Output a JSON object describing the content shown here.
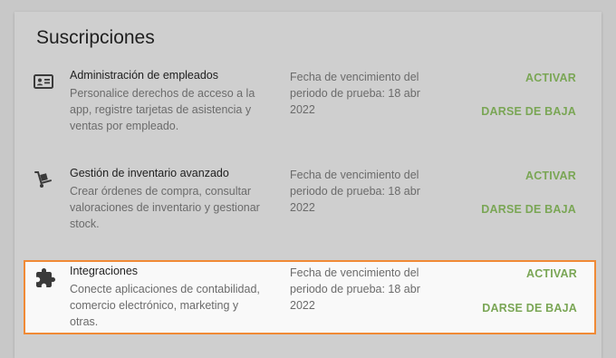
{
  "title": "Suscripciones",
  "accent_color": "#7aa655",
  "highlight_color": "#f08a36",
  "subscriptions": [
    {
      "icon": "id-card-icon",
      "name": "Administración de empleados",
      "description": "Personalice derechos de acceso a la app, registre tarjetas de asistencia y ventas por empleado.",
      "expiry": "Fecha de vencimiento del periodo de prueba: 18 abr 2022",
      "activate_label": "ACTIVAR",
      "unsubscribe_label": "DARSE DE BAJA"
    },
    {
      "icon": "hand-truck-icon",
      "name": "Gestión de inventario avanzado",
      "description": "Crear órdenes de compra, consultar valoraciones de inventario y gestionar stock.",
      "expiry": "Fecha de vencimiento del periodo de prueba: 18 abr 2022",
      "activate_label": "ACTIVAR",
      "unsubscribe_label": "DARSE DE BAJA"
    },
    {
      "icon": "puzzle-icon",
      "name": "Integraciones",
      "description": "Conecte aplicaciones de contabilidad, comercio electrónico, marketing y otras.",
      "expiry": "Fecha de vencimiento del periodo de prueba: 18 abr 2022",
      "activate_label": "ACTIVAR",
      "unsubscribe_label": "DARSE DE BAJA"
    }
  ]
}
